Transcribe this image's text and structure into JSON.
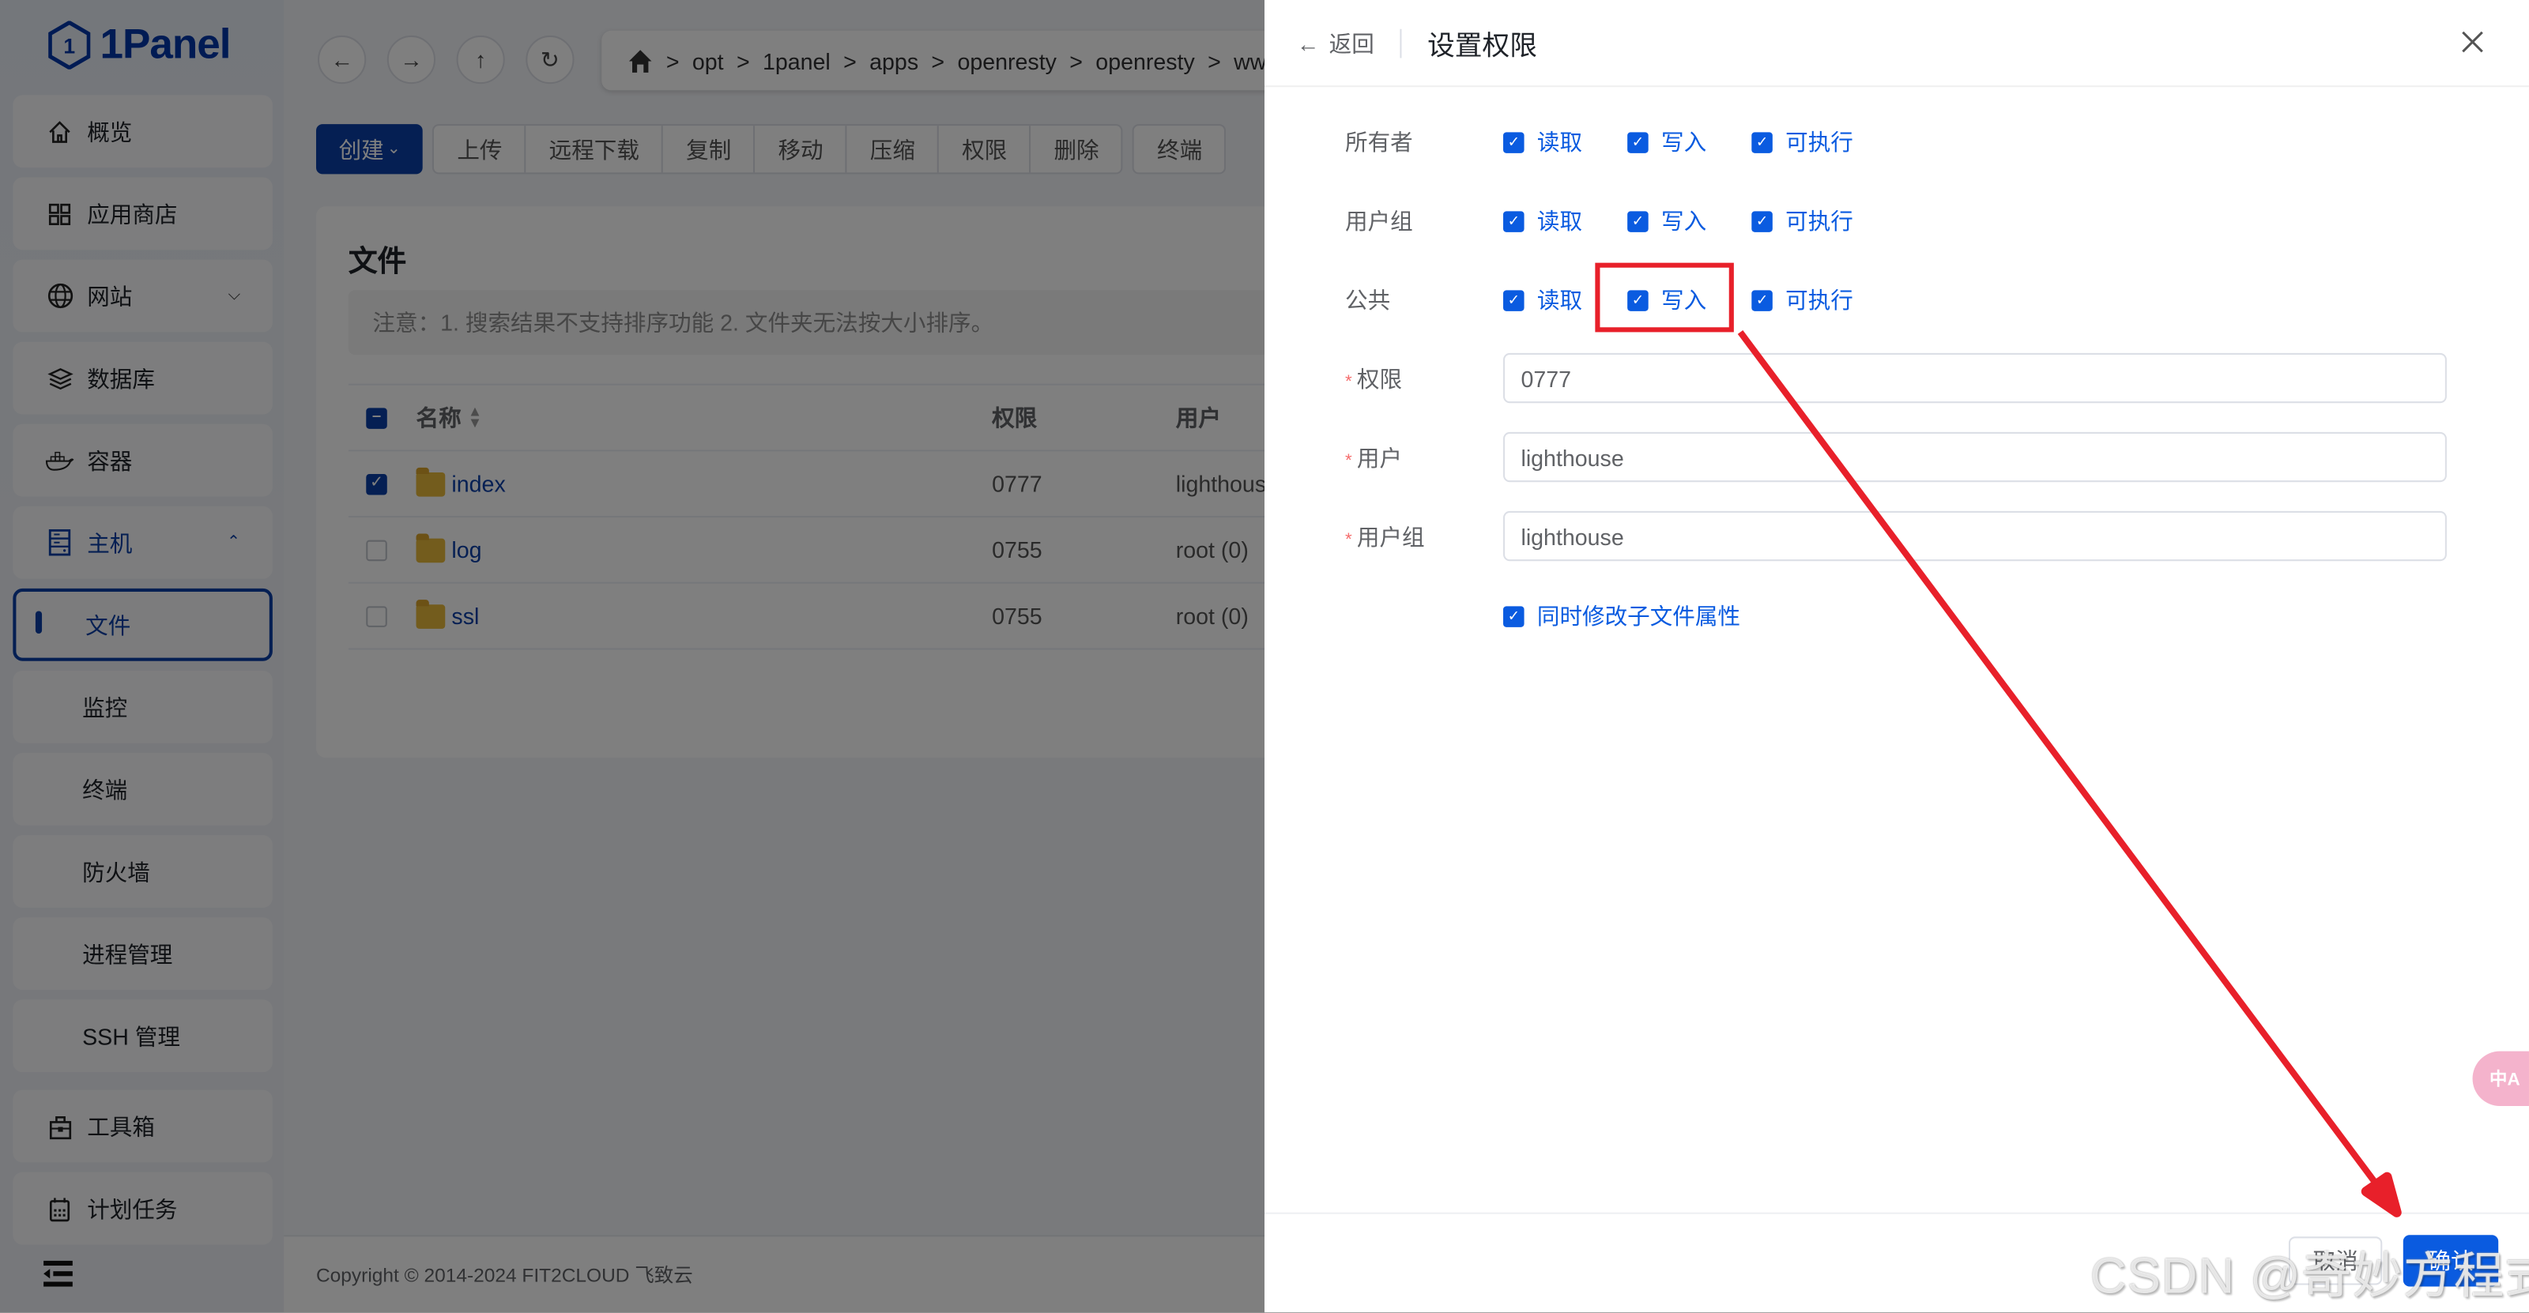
{
  "app": {
    "logo_text": "1Panel"
  },
  "sidebar": {
    "items": [
      {
        "label": "概览",
        "icon": "home-icon"
      },
      {
        "label": "应用商店",
        "icon": "apps-grid-icon"
      },
      {
        "label": "网站",
        "icon": "globe-icon",
        "expandable": true
      },
      {
        "label": "数据库",
        "icon": "database-layers-icon"
      },
      {
        "label": "容器",
        "icon": "docker-icon"
      },
      {
        "label": "主机",
        "icon": "server-icon",
        "expandable": true,
        "expanded": true
      },
      {
        "label": "文件",
        "sub": true,
        "active": true
      },
      {
        "label": "监控",
        "sub": true
      },
      {
        "label": "终端",
        "sub": true
      },
      {
        "label": "防火墙",
        "sub": true
      },
      {
        "label": "进程管理",
        "sub": true
      },
      {
        "label": "SSH 管理",
        "sub": true
      },
      {
        "label": "工具箱",
        "icon": "toolbox-icon"
      },
      {
        "label": "计划任务",
        "icon": "calendar-icon"
      }
    ]
  },
  "nav": {
    "path": [
      "opt",
      "1panel",
      "apps",
      "openresty",
      "openresty",
      "ww"
    ]
  },
  "toolbar": {
    "create_label": "创建",
    "group_buttons": [
      "上传",
      "远程下载",
      "复制",
      "移动",
      "压缩",
      "权限",
      "删除"
    ],
    "terminal_label": "终端"
  },
  "files": {
    "title": "文件",
    "notice": "注意：1. 搜索结果不支持排序功能 2. 文件夹无法按大小排序。",
    "columns": {
      "name": "名称",
      "permission": "权限",
      "user": "用户"
    },
    "rows": [
      {
        "name": "index",
        "permission": "0777",
        "user": "lighthous",
        "checked": true
      },
      {
        "name": "log",
        "permission": "0755",
        "user": "root (0)",
        "checked": false
      },
      {
        "name": "ssl",
        "permission": "0755",
        "user": "root (0)",
        "checked": false
      }
    ]
  },
  "footer": {
    "copyright": "Copyright © 2014-2024 FIT2CLOUD 飞致云"
  },
  "drawer": {
    "back_label": "返回",
    "title": "设置权限",
    "perm_rows": [
      {
        "label": "所有者",
        "read": "读取",
        "write": "写入",
        "exec": "可执行",
        "read_on": true,
        "write_on": true,
        "exec_on": true
      },
      {
        "label": "用户组",
        "read": "读取",
        "write": "写入",
        "exec": "可执行",
        "read_on": true,
        "write_on": true,
        "exec_on": true
      },
      {
        "label": "公共",
        "read": "读取",
        "write": "写入",
        "exec": "可执行",
        "read_on": true,
        "write_on": true,
        "exec_on": true
      }
    ],
    "fields": [
      {
        "label": "权限",
        "value": "0777",
        "required": true
      },
      {
        "label": "用户",
        "value": "lighthouse",
        "required": true
      },
      {
        "label": "用户组",
        "value": "lighthouse",
        "required": true
      }
    ],
    "recursive_label": "同时修改子文件属性",
    "recursive_checked": true,
    "cancel_label": "取消",
    "confirm_label": "确认"
  },
  "annotation": {
    "color": "#e8202a"
  },
  "translate_fab": {
    "label": "中A"
  },
  "watermark": {
    "text": "CSDN @奇妙方程式"
  },
  "colors": {
    "primary": "#0a3fa6",
    "drawer_primary": "#0a5be0",
    "folder": "#e6b83a"
  }
}
